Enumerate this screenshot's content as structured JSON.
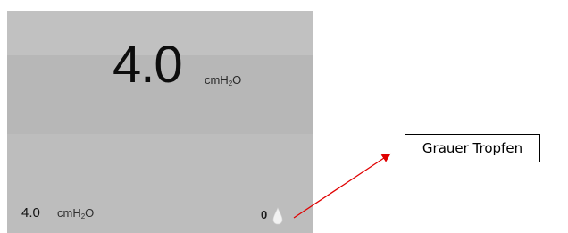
{
  "display": {
    "main_value": "4.0",
    "main_unit_prefix": "cmH",
    "main_unit_sub": "2",
    "main_unit_suffix": "O",
    "footer_value": "4.0",
    "footer_unit_prefix": "cmH",
    "footer_unit_sub": "2",
    "footer_unit_suffix": "O",
    "footer_count": "0",
    "drop_icon": "drop-icon"
  },
  "annotation": {
    "label": "Grauer Tropfen",
    "arrow_color": "#e00000"
  },
  "colors": {
    "panel_background": "#bcbcbc",
    "drop_fill": "#f2f2f2"
  }
}
